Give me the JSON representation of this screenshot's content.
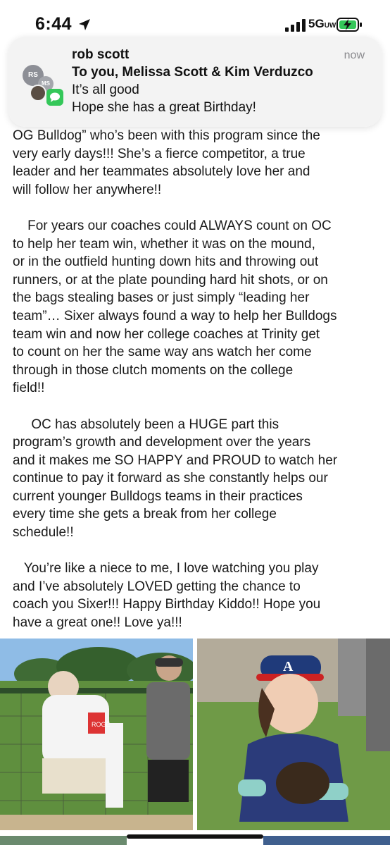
{
  "status_bar": {
    "time": "6:44",
    "network": "5G",
    "network_suffix": "UW",
    "icons": [
      "location-arrow-icon",
      "signal-bars-icon",
      "battery-charging-icon"
    ]
  },
  "notification": {
    "sender": "rob scott",
    "recipients": "To you, Melissa Scott & Kim Verduzco",
    "line1": "It’s all good",
    "line2": "Hope she has a great Birthday!",
    "time": "now",
    "avatar_initials": [
      "RS",
      "MS"
    ],
    "app_icon": "messages-icon"
  },
  "post": {
    "lines": [
      "OG Bulldog” who’s been with this program since the",
      "very early days!!! She’s a fierce competitor, a true",
      "leader and her teammates absolutely love her and",
      "will follow her anywhere!!",
      "",
      "    For years our coaches could ALWAYS count on OC",
      "to help her team win, whether it was on the mound,",
      "or in the outfield hunting down hits and throwing out",
      "runners, or at the plate pounding hard hit shots, or on",
      "the bags stealing bases or just simply “leading her",
      "team”… Sixer always found a way to help her Bulldogs",
      "team win and now her college coaches at Trinity get",
      "to count on her the same way ans watch her come",
      "through in those clutch moments on the college",
      "field!!",
      "",
      "     OC has absolutely been a HUGE part this",
      "program’s growth and development over the years",
      "and it makes me SO HAPPY and PROUD to watch her",
      "continue to pay it forward as she constantly helps our",
      "current younger Bulldogs teams in their practices",
      "every time she gets a break from her college",
      "schedule!!",
      "",
      "   You’re like a niece to me, I love watching you play",
      "and I’ve absolutely LOVED getting the chance to",
      "coach you Sixer!!! Happy Birthday Kiddo!! Hope you",
      "have a great one!! Love ya!!!"
    ]
  },
  "photos": [
    {
      "name": "softball-hug-photo",
      "jersey_text": "ROGE"
    },
    {
      "name": "girl-with-glove-photo",
      "cap_letter": "A"
    }
  ]
}
